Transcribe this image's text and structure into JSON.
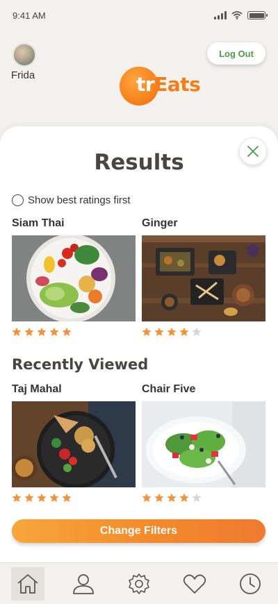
{
  "status_bar": {
    "time": "9:41 AM"
  },
  "user": {
    "name": "Frida"
  },
  "header": {
    "logout_label": "Log Out",
    "logo_first": "tr",
    "logo_rest": "Eats"
  },
  "results": {
    "title": "Results",
    "sort_option_label": "Show best ratings first",
    "items": [
      {
        "name": "Siam Thai",
        "rating": 5,
        "max_rating": 5
      },
      {
        "name": "Ginger",
        "rating": 4,
        "max_rating": 5
      }
    ]
  },
  "recently_viewed": {
    "title": "Recently Viewed",
    "items": [
      {
        "name": "Taj Mahal",
        "rating": 5,
        "max_rating": 5
      },
      {
        "name": "Chair Five",
        "rating": 4,
        "max_rating": 5
      }
    ]
  },
  "change_filters_label": "Change Filters",
  "tabbar": {
    "tabs": [
      {
        "icon": "home-icon",
        "active": true
      },
      {
        "icon": "user-icon",
        "active": false
      },
      {
        "icon": "gear-icon",
        "active": false
      },
      {
        "icon": "heart-icon",
        "active": false
      },
      {
        "icon": "clock-icon",
        "active": false
      }
    ]
  },
  "colors": {
    "accent": "#f48a2b",
    "star_on": "#f4923a",
    "star_off": "#d6d6d6",
    "logout_text": "#4a9a4a",
    "close_icon": "#4a9a4a"
  }
}
